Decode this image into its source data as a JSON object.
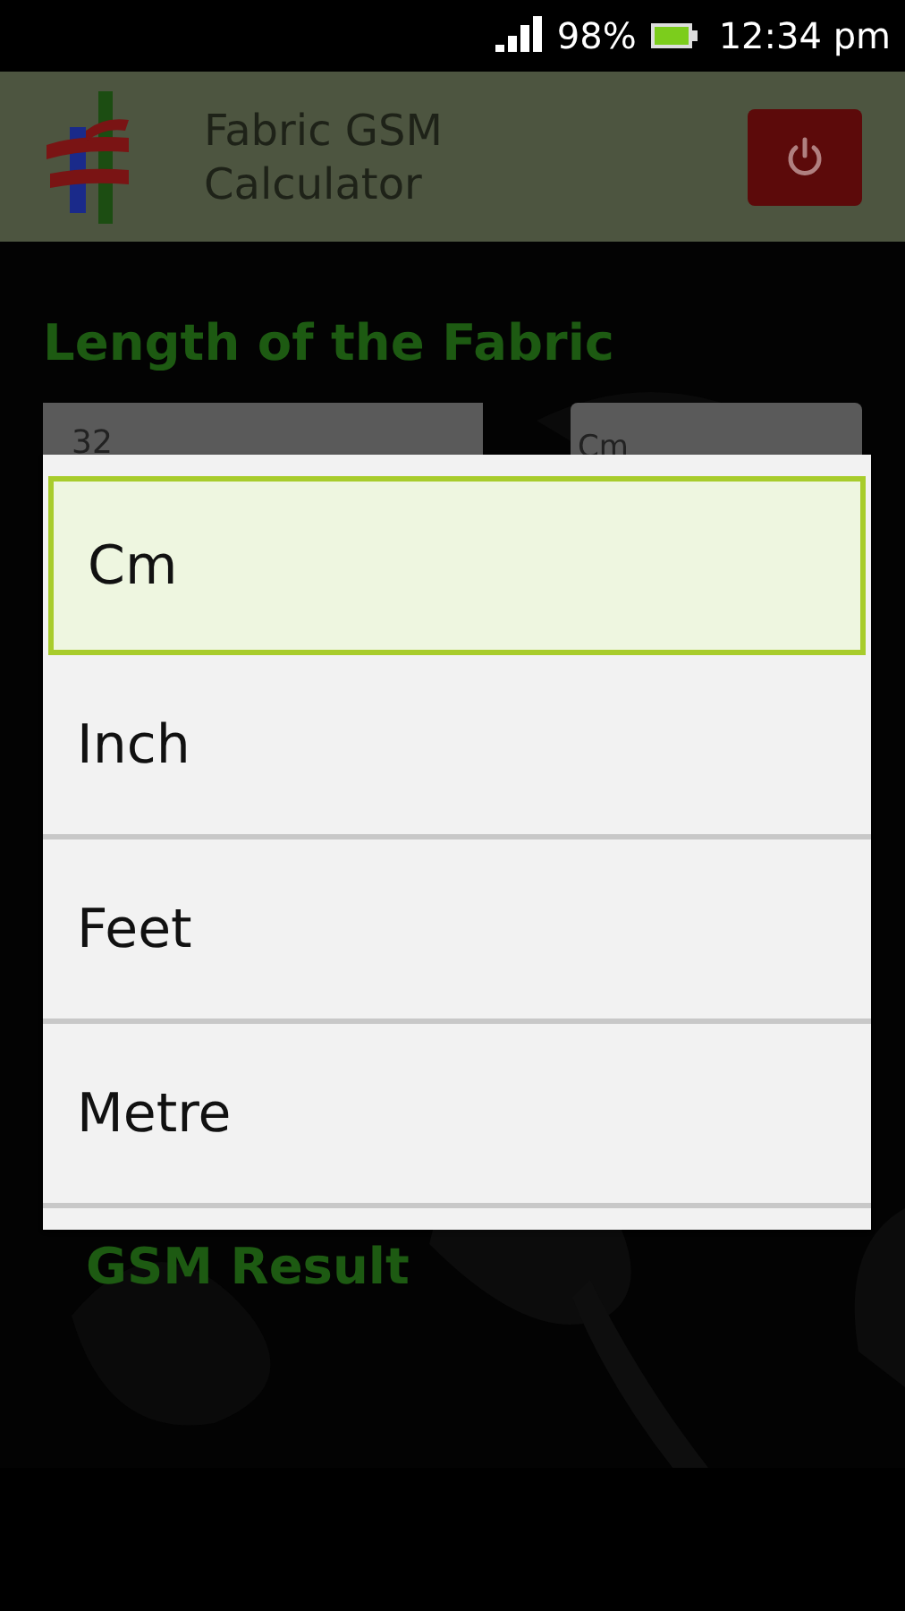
{
  "status_bar": {
    "battery": "98%",
    "time": "12:34 pm"
  },
  "app_bar": {
    "title": "Fabric GSM Calculator"
  },
  "form": {
    "length_label": "Length of the Fabric",
    "length_value": "32",
    "length_unit": "Cm",
    "result_label": "GSM Result"
  },
  "unit_menu": {
    "options": [
      {
        "label": "Cm",
        "selected": true
      },
      {
        "label": "Inch",
        "selected": false
      },
      {
        "label": "Feet",
        "selected": false
      },
      {
        "label": "Metre",
        "selected": false
      }
    ]
  }
}
